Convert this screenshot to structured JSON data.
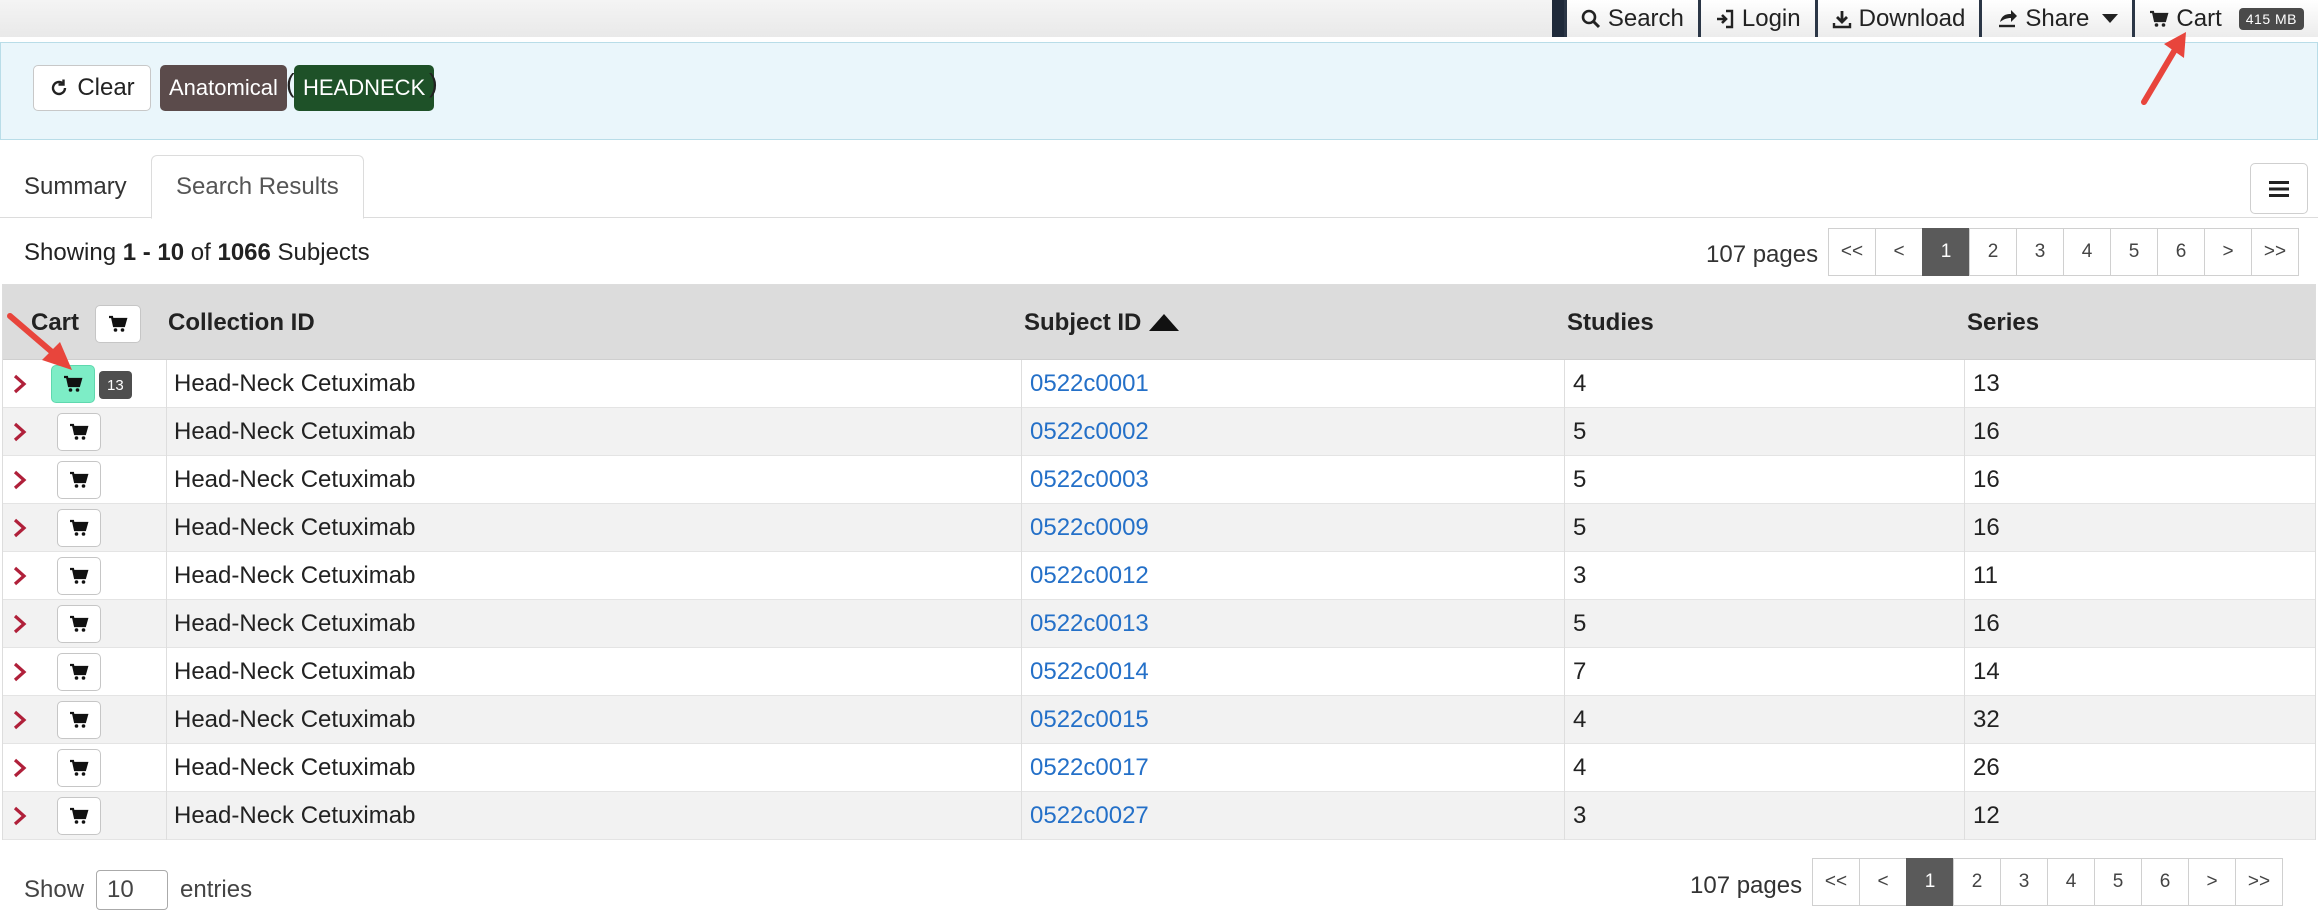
{
  "nav": {
    "search": "Search",
    "login": "Login",
    "download": "Download",
    "share": "Share",
    "cart": "Cart",
    "cart_size": "415 MB"
  },
  "filters": {
    "clear": "Clear",
    "category": "Anatomical",
    "open_paren": "(",
    "value": "HEADNECK",
    "close_paren": ")"
  },
  "tabs": [
    {
      "label": "Summary",
      "active": false
    },
    {
      "label": "Search Results",
      "active": true
    }
  ],
  "results": {
    "showing_prefix": "Showing ",
    "range_start": "1",
    "range_sep": " - ",
    "range_end": "10",
    "of": " of ",
    "total": "1066",
    "unit": " Subjects",
    "pages_label": "107 pages",
    "pager": [
      "<<",
      "<",
      "1",
      "2",
      "3",
      "4",
      "5",
      "6",
      ">",
      ">>"
    ],
    "active_page": "1"
  },
  "table": {
    "columns": {
      "cart": "Cart",
      "collection": "Collection ID",
      "subject": "Subject ID",
      "studies": "Studies",
      "series": "Series"
    },
    "rows": [
      {
        "collection": "Head-Neck Cetuximab",
        "subject": "0522c0001",
        "studies": "4",
        "series": "13",
        "in_cart": true,
        "cart_count": "13"
      },
      {
        "collection": "Head-Neck Cetuximab",
        "subject": "0522c0002",
        "studies": "5",
        "series": "16",
        "in_cart": false
      },
      {
        "collection": "Head-Neck Cetuximab",
        "subject": "0522c0003",
        "studies": "5",
        "series": "16",
        "in_cart": false
      },
      {
        "collection": "Head-Neck Cetuximab",
        "subject": "0522c0009",
        "studies": "5",
        "series": "16",
        "in_cart": false
      },
      {
        "collection": "Head-Neck Cetuximab",
        "subject": "0522c0012",
        "studies": "3",
        "series": "11",
        "in_cart": false
      },
      {
        "collection": "Head-Neck Cetuximab",
        "subject": "0522c0013",
        "studies": "5",
        "series": "16",
        "in_cart": false
      },
      {
        "collection": "Head-Neck Cetuximab",
        "subject": "0522c0014",
        "studies": "7",
        "series": "14",
        "in_cart": false
      },
      {
        "collection": "Head-Neck Cetuximab",
        "subject": "0522c0015",
        "studies": "4",
        "series": "32",
        "in_cart": false
      },
      {
        "collection": "Head-Neck Cetuximab",
        "subject": "0522c0017",
        "studies": "4",
        "series": "26",
        "in_cart": false
      },
      {
        "collection": "Head-Neck Cetuximab",
        "subject": "0522c0027",
        "studies": "3",
        "series": "12",
        "in_cart": false
      }
    ]
  },
  "footer": {
    "show": "Show",
    "entries_value": "10",
    "entries": "entries"
  },
  "colors": {
    "accent_link": "#2470c8",
    "added_cart": "#7dedc6",
    "headneck_tag": "#1e5128",
    "anatomical_tag": "#5b4b4b",
    "annotation_arrow": "#e8453c",
    "expander": "#b0203a"
  }
}
